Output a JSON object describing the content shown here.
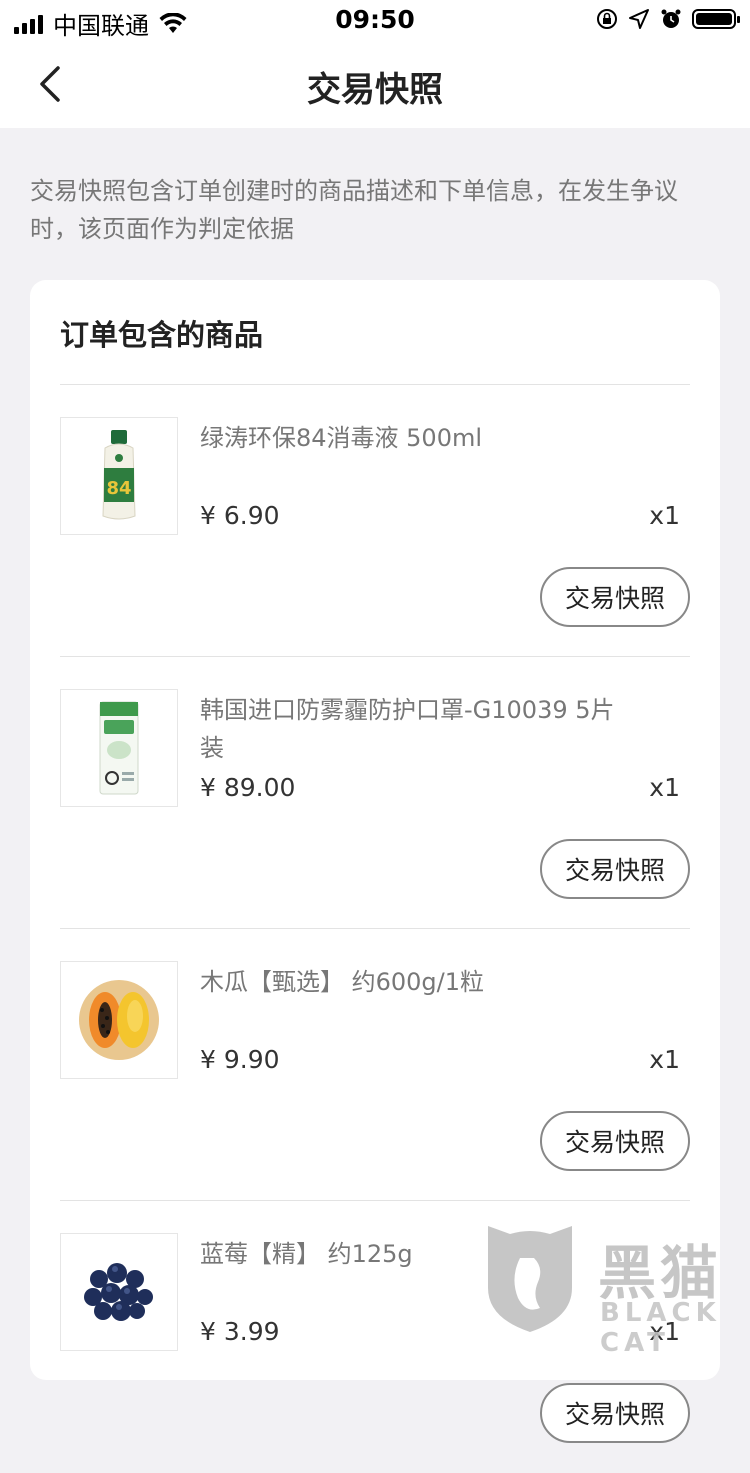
{
  "status_bar": {
    "carrier": "中国联通",
    "time": "09:50"
  },
  "nav": {
    "title": "交易快照"
  },
  "notice": "交易快照包含订单创建时的商品描述和下单信息，在发生争议时，该页面作为判定依据",
  "card": {
    "title": "订单包含的商品",
    "items": [
      {
        "name": "绿涛环保84消毒液 500ml",
        "price": "¥ 6.90",
        "qty": "x1",
        "button": "交易快照",
        "thumb_icon": "disinfectant-bottle-icon"
      },
      {
        "name": "韩国进口防雾霾防护口罩-G10039 5片装",
        "price": "¥ 89.00",
        "qty": "x1",
        "button": "交易快照",
        "thumb_icon": "mask-package-icon"
      },
      {
        "name": "木瓜【甄选】 约600g/1粒",
        "price": "¥ 9.90",
        "qty": "x1",
        "button": "交易快照",
        "thumb_icon": "papaya-icon"
      },
      {
        "name": "蓝莓【精】 约125g",
        "price": "¥ 3.99",
        "qty": "x1",
        "button": "交易快照",
        "thumb_icon": "blueberry-icon"
      }
    ]
  },
  "watermark": {
    "cn": "黑猫",
    "en": "BLACK CAT"
  },
  "colors": {
    "background": "#f2f1f4",
    "card": "#ffffff",
    "muted_text": "#777777",
    "button_border": "#888888"
  }
}
